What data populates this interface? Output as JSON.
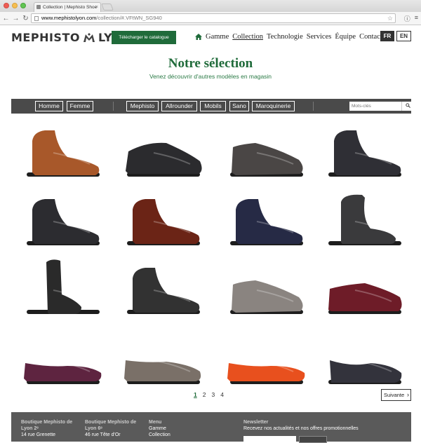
{
  "browser": {
    "tab_title": "Collection | Mephisto Shoe",
    "url_host": "www.mephistolyon.com",
    "url_path": "/collection/#.VFtWN_SG940"
  },
  "header": {
    "logo_text": "MEPHISTO",
    "logo_city": "LYON",
    "catalog_button": "Télécharger le catalogue",
    "nav": [
      "Gamme",
      "Collection",
      "Technologie",
      "Services",
      "Équipe",
      "Contact"
    ],
    "lang_fr": "FR",
    "lang_en": "EN"
  },
  "main": {
    "title": "Notre sélection",
    "subtitle": "Venez découvrir d'autres modèles en magasin"
  },
  "filters": {
    "gender": [
      "Homme",
      "Femme"
    ],
    "brands": [
      "Mephisto",
      "Allrounder",
      "Mobils",
      "Sano",
      "Maroquinerie"
    ],
    "search_placeholder": "Mots-clés"
  },
  "products": [
    {
      "type": "ankle-boot",
      "color": "#a8582a"
    },
    {
      "type": "sneaker",
      "color": "#2b2b2e"
    },
    {
      "type": "low-boot",
      "color": "#4a4645"
    },
    {
      "type": "ankle-boot",
      "color": "#2f2f35"
    },
    {
      "type": "ankle-boot",
      "color": "#2c2c30"
    },
    {
      "type": "ankle-boot",
      "color": "#6b2416"
    },
    {
      "type": "ankle-boot",
      "color": "#262a45"
    },
    {
      "type": "fur-boot",
      "color": "#3a3a3c"
    },
    {
      "type": "tall-boot",
      "color": "#2a2a2a"
    },
    {
      "type": "ankle-boot",
      "color": "#323232"
    },
    {
      "type": "low-boot",
      "color": "#8a8480"
    },
    {
      "type": "oxford",
      "color": "#6e1c28"
    },
    {
      "type": "flat",
      "color": "#5e2440"
    },
    {
      "type": "mary-jane",
      "color": "#7a7068"
    },
    {
      "type": "flat",
      "color": "#e8501e"
    },
    {
      "type": "pump",
      "color": "#33333c"
    }
  ],
  "pagination": {
    "pages": [
      "1",
      "2",
      "3",
      "4"
    ],
    "next_label": "Suivante"
  },
  "footer": {
    "col1_title": "Boutique Mephisto de Lyon 2ᵉ",
    "col1_addr": "14 rue Grenette",
    "col2_title": "Boutique Mephisto de Lyon 6ᵉ",
    "col2_addr": "46 rue Tête d'Or",
    "col3_title": "Menu",
    "col3_items": [
      "Gamme",
      "Collection"
    ],
    "col4_title": "Newsletter",
    "col4_text": "Recevez nos actualités et nos offres promotionnelles"
  },
  "colors": {
    "brand_green": "#1f6b3a",
    "filter_bar": "#4a4a4a",
    "footer_bg": "#5a5a5a"
  }
}
